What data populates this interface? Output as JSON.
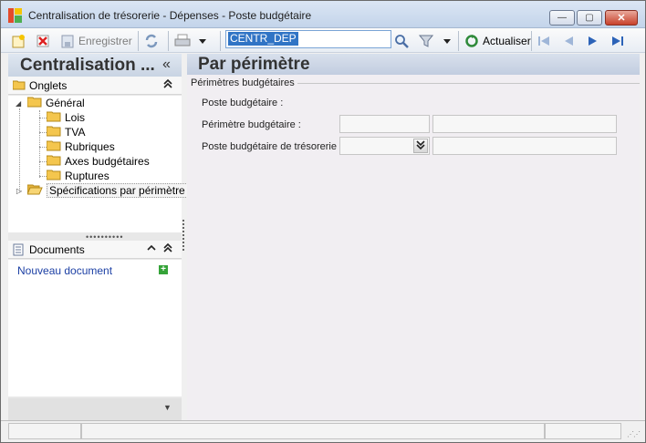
{
  "window": {
    "title": "Centralisation de trésorerie - Dépenses -  Poste budgétaire",
    "minimize": "—",
    "maximize": "▢",
    "close": "✕"
  },
  "toolbar": {
    "save_label": "Enregistrer",
    "search_value": "CENTR_DEP",
    "refresh_label": "Actualiser"
  },
  "left_panel": {
    "title": "Centralisation ...",
    "collapse_glyph": "«",
    "tabs_section": {
      "label": "Onglets",
      "toggle_glyph": "⌃",
      "tree": {
        "root": "Général",
        "children": [
          "Lois",
          "TVA",
          "Rubriques",
          "Axes budgétaires",
          "Ruptures"
        ],
        "second_root": "Spécifications par périmètre"
      }
    },
    "documents_section": {
      "label": "Documents",
      "new_document": "Nouveau document"
    }
  },
  "main": {
    "title": "Par périmètre",
    "group_label": "Périmètres budgétaires",
    "fields": [
      {
        "label": "Poste budgétaire :"
      },
      {
        "label": "Périmètre budgétaire :",
        "value1": "",
        "value2": ""
      },
      {
        "label": "Poste budgétaire de trésorerie :",
        "value1": "",
        "value2": ""
      }
    ]
  },
  "colors": {
    "accent_blue": "#3074c5",
    "header_gradient": "#c9d4e3",
    "link": "#1b3fa4"
  },
  "icons": {
    "new": "new-record-icon",
    "delete": "delete-icon",
    "save": "save-icon",
    "refresh": "refresh-icon",
    "print": "print-icon",
    "search": "search-icon",
    "filter": "filter-icon",
    "nav_first": "first-record-icon",
    "nav_prev": "previous-record-icon",
    "nav_next": "next-record-icon",
    "nav_last": "last-record-icon"
  }
}
